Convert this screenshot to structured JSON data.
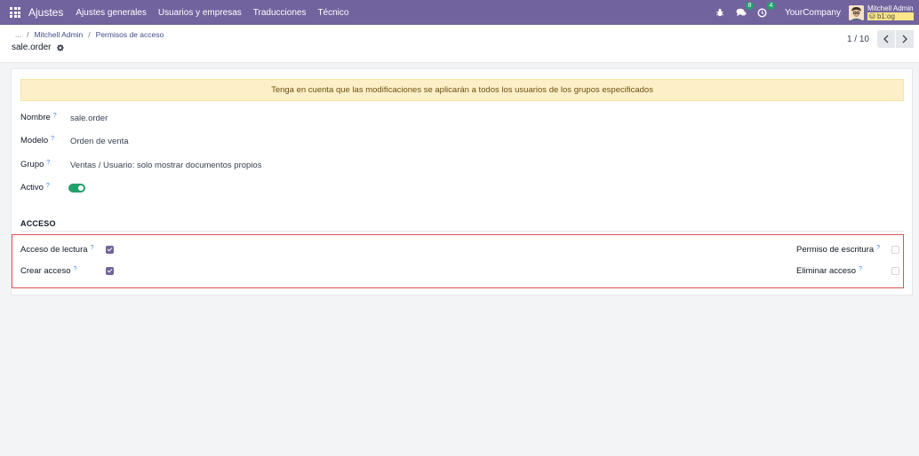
{
  "navbar": {
    "brand": "Ajustes",
    "menu": [
      "Ajustes generales",
      "Usuarios y empresas",
      "Traducciones",
      "Técnico"
    ],
    "messages_badge": "8",
    "activities_badge": "4",
    "company": "YourCompany",
    "user_name": "Mitchell Admin",
    "db_name": "b1:og"
  },
  "breadcrumb": {
    "ellipsis": "...",
    "sep": "/",
    "items": [
      "Mitchell Admin",
      "Permisos de acceso"
    ]
  },
  "record": {
    "title": "sale.order"
  },
  "pager": {
    "value": "1 / 10"
  },
  "alert": {
    "text": "Tenga en cuenta que las modificaciones se aplicarán a todos los usuarios de los grupos especificados"
  },
  "form": {
    "help_mark": "?",
    "name_label": "Nombre",
    "name_value": "sale.order",
    "model_label": "Modelo",
    "model_value": "Orden de venta",
    "group_label": "Grupo",
    "group_value": "Ventas / Usuario: solo mostrar documentos propios",
    "active_label": "Activo",
    "active": true
  },
  "access": {
    "title": "ACCESO",
    "read_label": "Acceso de lectura",
    "read": true,
    "create_label": "Crear acceso",
    "create": true,
    "write_label": "Permiso de escritura",
    "write": false,
    "unlink_label": "Eliminar acceso",
    "unlink": false
  },
  "colors": {
    "navbar": "#71639e",
    "accent": "#71639e",
    "toggle_on": "#22a06b",
    "alert_bg": "#fdf0c8",
    "highlight_border": "#e05252"
  }
}
